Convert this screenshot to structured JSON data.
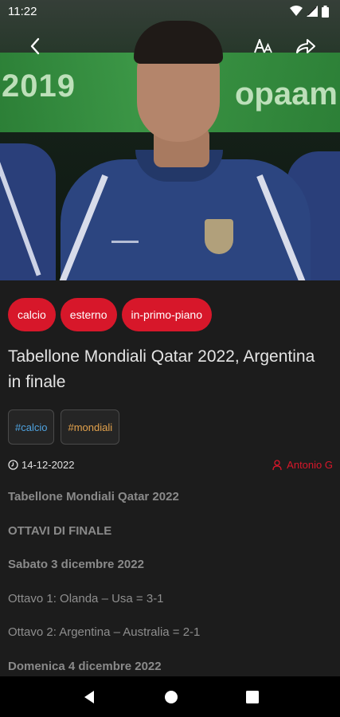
{
  "status_bar": {
    "time": "11:22"
  },
  "hero": {
    "image_name": "coach-photo",
    "banner_left_text": "2019",
    "banner_right_text": "opaam"
  },
  "app_bar": {
    "back_icon": "chevron-left-icon",
    "text_size_icon": "text-size-icon",
    "share_icon": "share-icon"
  },
  "categories": [
    "calcio",
    "esterno",
    "in-primo-piano"
  ],
  "article": {
    "title": "Tabellone Mondiali Qatar 2022, Argentina in finale",
    "hashtags": [
      "#calcio",
      "#mondiali"
    ],
    "date": "14-12-2022",
    "author": "Antonio G",
    "paragraphs": [
      {
        "text": "Tabellone Mondiali Qatar 2022",
        "bold": true
      },
      {
        "text": "OTTAVI DI FINALE",
        "bold": true
      },
      {
        "text": "Sabato 3 dicembre 2022",
        "bold": true
      },
      {
        "text": "Ottavo 1: Olanda – Usa = 3-1",
        "bold": false
      },
      {
        "text": "Ottavo 2: Argentina – Australia = 2-1",
        "bold": false
      },
      {
        "text": "Domenica 4 dicembre 2022",
        "bold": true
      }
    ]
  },
  "colors": {
    "accent": "#d7172a",
    "background": "#1c1c1c",
    "hashtag_blue": "#4fa3e0",
    "hashtag_orange": "#e3a24c"
  },
  "nav_bar": {
    "back": "back-triangle-icon",
    "home": "home-circle-icon",
    "recents": "recents-square-icon"
  }
}
